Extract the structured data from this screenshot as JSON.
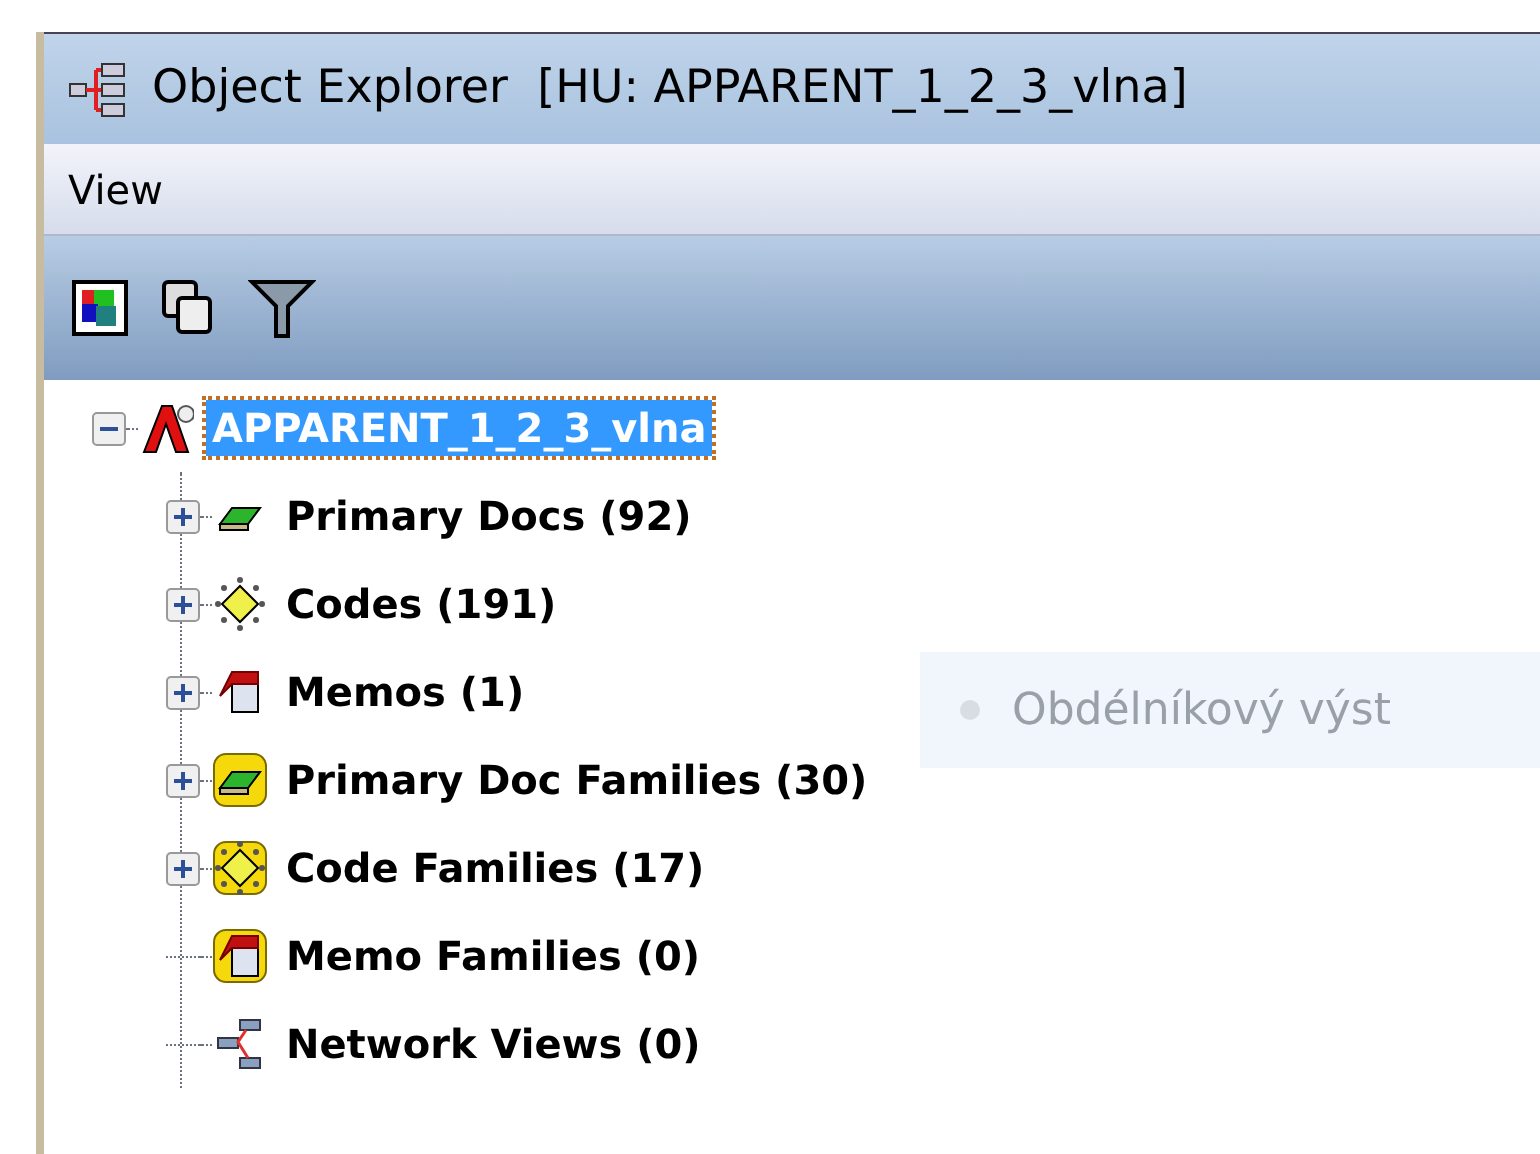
{
  "window": {
    "title": "Object Explorer  [HU: APPARENT_1_2_3_vlna]"
  },
  "menu": [
    "View"
  ],
  "toolbar": [
    {
      "kind": "colors"
    },
    {
      "kind": "copy"
    },
    {
      "kind": "filter"
    }
  ],
  "tree": {
    "label": "APPARENT_1_2_3_vlna",
    "kind": "project",
    "selected": true,
    "expanded": true,
    "children": [
      {
        "label": "Primary Docs (92)",
        "kind": "docs",
        "selected": false,
        "expandable": true
      },
      {
        "label": "Codes (191)",
        "kind": "codes",
        "selected": false,
        "expandable": true
      },
      {
        "label": "Memos (1)",
        "kind": "memos",
        "selected": false,
        "expandable": true
      },
      {
        "label": "Primary Doc Families (30)",
        "kind": "doc-families",
        "selected": false,
        "expandable": true
      },
      {
        "label": "Code Families (17)",
        "kind": "code-families",
        "selected": false,
        "expandable": true
      },
      {
        "label": "Memo Families (0)",
        "kind": "memo-families",
        "selected": false,
        "expandable": false
      },
      {
        "label": "Network Views (0)",
        "kind": "network",
        "selected": false,
        "expandable": false
      }
    ]
  },
  "overlay": {
    "text": "Obdélníkový výst"
  }
}
